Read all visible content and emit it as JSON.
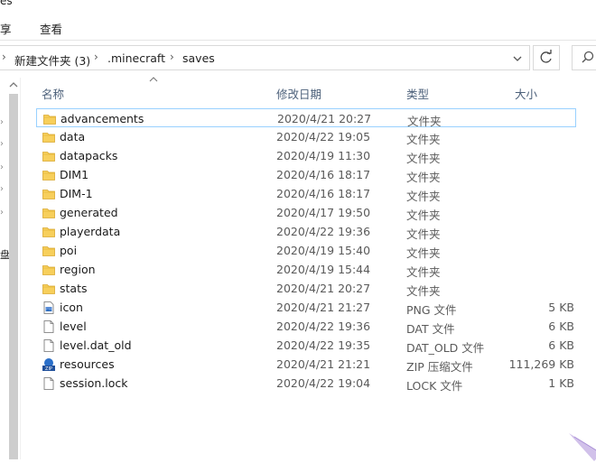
{
  "window": {
    "title_fragment": "es"
  },
  "ribbon": {
    "tabs": [
      {
        "label": "享"
      },
      {
        "label": "查看"
      }
    ]
  },
  "address": {
    "crumbs": [
      {
        "label": "新建文件夹 (3)"
      },
      {
        "label": ".minecraft"
      },
      {
        "label": "saves"
      }
    ]
  },
  "nav_pane": {
    "cut_label": "盘"
  },
  "columns": {
    "name": "名称",
    "date": "修改日期",
    "type": "类型",
    "size": "大小"
  },
  "files": [
    {
      "name": "advancements",
      "date": "2020/4/21 20:27",
      "type": "文件夹",
      "size": "",
      "icon": "folder-icon",
      "selected": true
    },
    {
      "name": "data",
      "date": "2020/4/22 19:05",
      "type": "文件夹",
      "size": "",
      "icon": "folder-icon"
    },
    {
      "name": "datapacks",
      "date": "2020/4/19 11:30",
      "type": "文件夹",
      "size": "",
      "icon": "folder-icon"
    },
    {
      "name": "DIM1",
      "date": "2020/4/16 18:17",
      "type": "文件夹",
      "size": "",
      "icon": "folder-icon"
    },
    {
      "name": "DIM-1",
      "date": "2020/4/16 18:17",
      "type": "文件夹",
      "size": "",
      "icon": "folder-icon"
    },
    {
      "name": "generated",
      "date": "2020/4/17 19:50",
      "type": "文件夹",
      "size": "",
      "icon": "folder-icon"
    },
    {
      "name": "playerdata",
      "date": "2020/4/22 19:36",
      "type": "文件夹",
      "size": "",
      "icon": "folder-icon"
    },
    {
      "name": "poi",
      "date": "2020/4/19 15:40",
      "type": "文件夹",
      "size": "",
      "icon": "folder-icon"
    },
    {
      "name": "region",
      "date": "2020/4/19 15:44",
      "type": "文件夹",
      "size": "",
      "icon": "folder-icon"
    },
    {
      "name": "stats",
      "date": "2020/4/21 20:27",
      "type": "文件夹",
      "size": "",
      "icon": "folder-icon"
    },
    {
      "name": "icon",
      "date": "2020/4/21 21:27",
      "type": "PNG 文件",
      "size": "5 KB",
      "icon": "image-file-icon"
    },
    {
      "name": "level",
      "date": "2020/4/22 19:36",
      "type": "DAT 文件",
      "size": "6 KB",
      "icon": "file-icon"
    },
    {
      "name": "level.dat_old",
      "date": "2020/4/22 19:35",
      "type": "DAT_OLD 文件",
      "size": "6 KB",
      "icon": "file-icon"
    },
    {
      "name": "resources",
      "date": "2020/4/21 21:21",
      "type": "ZIP 压缩文件",
      "size": "111,269 KB",
      "icon": "zip-file-icon"
    },
    {
      "name": "session.lock",
      "date": "2020/4/22 19:04",
      "type": "LOCK 文件",
      "size": "1 KB",
      "icon": "file-icon"
    }
  ],
  "colors": {
    "accent_selected_border": "#99d1ff",
    "header_text": "#4c607a",
    "folder": "#f7cf5b"
  }
}
